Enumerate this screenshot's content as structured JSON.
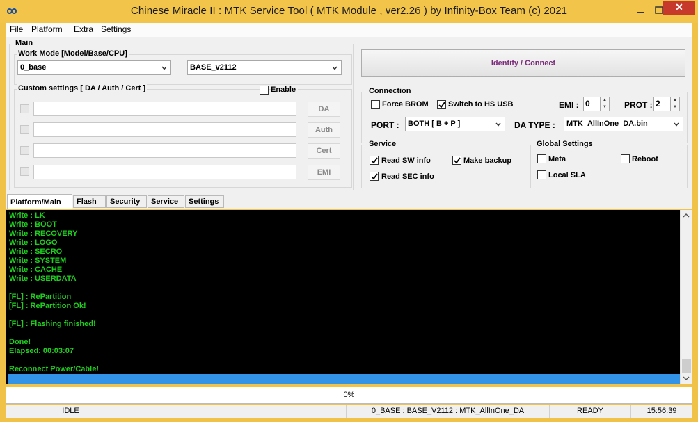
{
  "window": {
    "title": "Chinese Miracle II : MTK Service Tool ( MTK Module , ver2.26  ) by Infinity-Box Team (c) 2021",
    "close_glyph": "✕",
    "accent": "#f2c449"
  },
  "menu": [
    "File",
    "Platform",
    "Extra",
    "Settings"
  ],
  "main_group": {
    "title": "Main",
    "work_mode": {
      "title": "Work Mode [Model/Base/CPU]",
      "model_value": "0_base",
      "base_value": "BASE_v2112"
    },
    "custom_settings": {
      "title": "Custom settings [ DA / Auth / Cert ]",
      "enable_label": "Enable",
      "buttons": [
        "DA",
        "Auth",
        "Cert",
        "EMI"
      ]
    }
  },
  "identify_button": {
    "label": "Identify / Connect",
    "color": "#7a2a7a"
  },
  "connection": {
    "title": "Connection",
    "force_brom": {
      "label": "Force BROM",
      "checked": false
    },
    "switch_hs_usb": {
      "label": "Switch to HS USB",
      "checked": true
    },
    "emi_label": "EMI :",
    "emi_value": "0",
    "prot_label": "PROT :",
    "prot_value": "2",
    "port_label": "PORT :",
    "port_value": "BOTH [ B + P ]",
    "da_type_label": "DA TYPE :",
    "da_type_value": "MTK_AllInOne_DA.bin"
  },
  "service": {
    "title": "Service",
    "read_sw_info": {
      "label": "Read SW info",
      "checked": true
    },
    "make_backup": {
      "label": "Make backup",
      "checked": true
    },
    "read_sec_info": {
      "label": "Read SEC info",
      "checked": true
    }
  },
  "global_settings": {
    "title": "Global Settings",
    "meta": {
      "label": "Meta",
      "checked": false
    },
    "reboot": {
      "label": "Reboot",
      "checked": false
    },
    "local_sla": {
      "label": "Local SLA",
      "checked": false
    }
  },
  "tabs": [
    "Platform/Main",
    "Flash",
    "Security",
    "Service",
    "Settings"
  ],
  "console": {
    "lines": [
      "Write : LK",
      "Write : BOOT",
      "Write : RECOVERY",
      "Write : LOGO",
      "Write : SECRO",
      "Write : SYSTEM",
      "Write : CACHE",
      "Write : USERDATA",
      "",
      "[FL] : RePartition",
      "[FL] : RePartition Ok!",
      "",
      "[FL] : Flashing finished!",
      "",
      "Done!",
      "Elapsed: 00:03:07",
      "",
      "Reconnect Power/Cable!"
    ],
    "text_color": "#1ed01e",
    "selection_color": "#3393e6"
  },
  "progress": {
    "value": 0,
    "label": "0%"
  },
  "status": {
    "state": "IDLE",
    "summary": "0_BASE : BASE_V2112 : MTK_AllInOne_DA",
    "ready": "READY",
    "time": "15:56:39"
  }
}
